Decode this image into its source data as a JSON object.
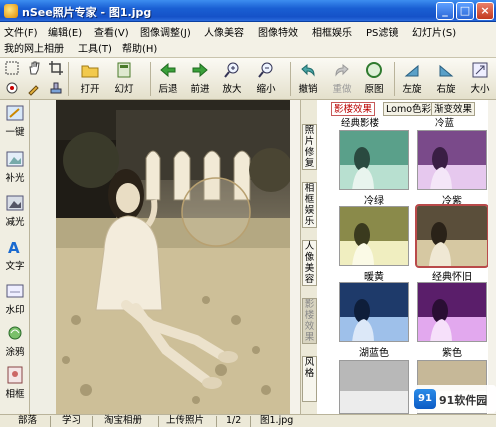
{
  "window": {
    "title": "nSee照片专家 - 图1.jpg",
    "minimize": "_",
    "maximize": "□",
    "close": "×"
  },
  "menu": {
    "row1": [
      "文件(F)",
      "编辑(E)",
      "查看(V)",
      "图像调整(J)",
      "人像美容",
      "图像特效",
      "相框娱乐",
      "PS滤镜",
      "幻灯片(S)"
    ],
    "row2": [
      "我的网上相册",
      "工具(T)",
      "帮助(H)"
    ]
  },
  "toolbar": {
    "open": "打开",
    "slideshow": "幻灯",
    "back": "后退",
    "forward": "前进",
    "zoom_in": "放大",
    "zoom_out": "缩小",
    "undo": "撤销",
    "redo": "重做",
    "original": "原图",
    "rotate_left": "左旋",
    "rotate_right": "右旋",
    "size": "大小"
  },
  "sidebar": {
    "items": [
      "一键",
      "补光",
      "减光",
      "文字",
      "水印",
      "涂鸦",
      "相框"
    ]
  },
  "vertical_tabs": [
    "照片修复",
    "相框娱乐",
    "人像美容",
    "影楼效果",
    "风格"
  ],
  "effects": {
    "tabs": [
      "影楼效果",
      "Lomo色彩",
      "渐变效果"
    ],
    "category_left": "经典影楼",
    "category_right": "冷蓝",
    "thumbnails": [
      {
        "label": "冷绿"
      },
      {
        "label": "冷紫"
      },
      {
        "label": "暖黄"
      },
      {
        "label": "经典怀旧"
      },
      {
        "label": "湖蓝色"
      },
      {
        "label": "紫色"
      }
    ]
  },
  "status": {
    "items": [
      "部落",
      "学习",
      "淘宝相册",
      "上传照片"
    ],
    "page": "1/2",
    "filename": "图1.jpg"
  },
  "watermark": {
    "logo": "91",
    "text": "91软件园"
  },
  "colors": {
    "titlebar": "#1a5fd3",
    "selected_border": "#b94a4a",
    "active_tab": "#b00000"
  }
}
